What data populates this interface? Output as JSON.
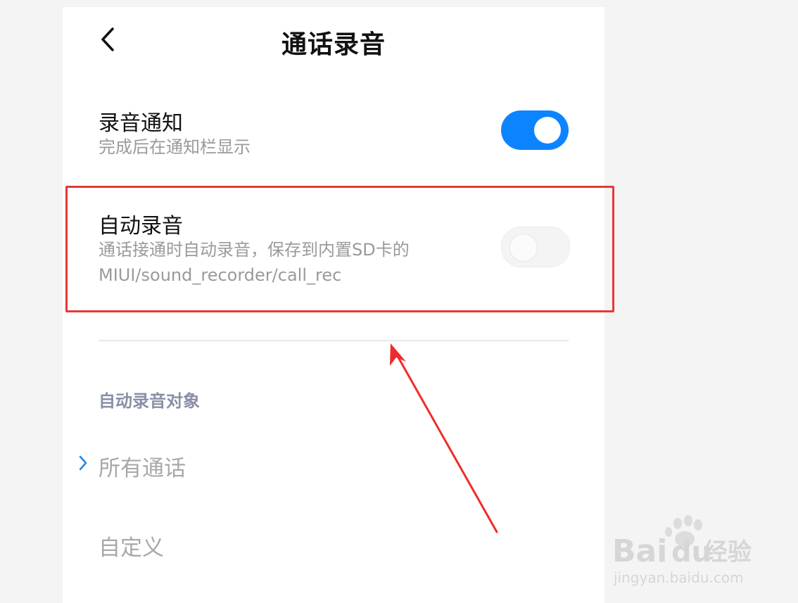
{
  "header": {
    "title": "通话录音"
  },
  "settings": {
    "notify": {
      "title": "录音通知",
      "subtitle": "完成后在通知栏显示",
      "enabled": true
    },
    "auto_record": {
      "title": "自动录音",
      "subtitle_line1": "通话接通时自动录音，保存到内置SD卡的",
      "subtitle_line2": "MIUI/sound_recorder/call_rec",
      "enabled": false
    }
  },
  "auto_record_target": {
    "header": "自动录音对象",
    "options": [
      {
        "label": "所有通话",
        "selected": true
      },
      {
        "label": "自定义",
        "selected": false
      }
    ]
  },
  "watermark": {
    "brand_latin_1": "Bai",
    "brand_latin_2": "du",
    "brand_cn": "经验",
    "url": "jingyan.baidu.com"
  },
  "colors": {
    "accent": "#0d84ff",
    "highlight": "#e53935"
  },
  "icons": {
    "back": "back-arrow-icon",
    "selected_option": "chevron-right-icon",
    "annotation": "red-arrow-icon",
    "watermark_logo": "paw-icon"
  }
}
